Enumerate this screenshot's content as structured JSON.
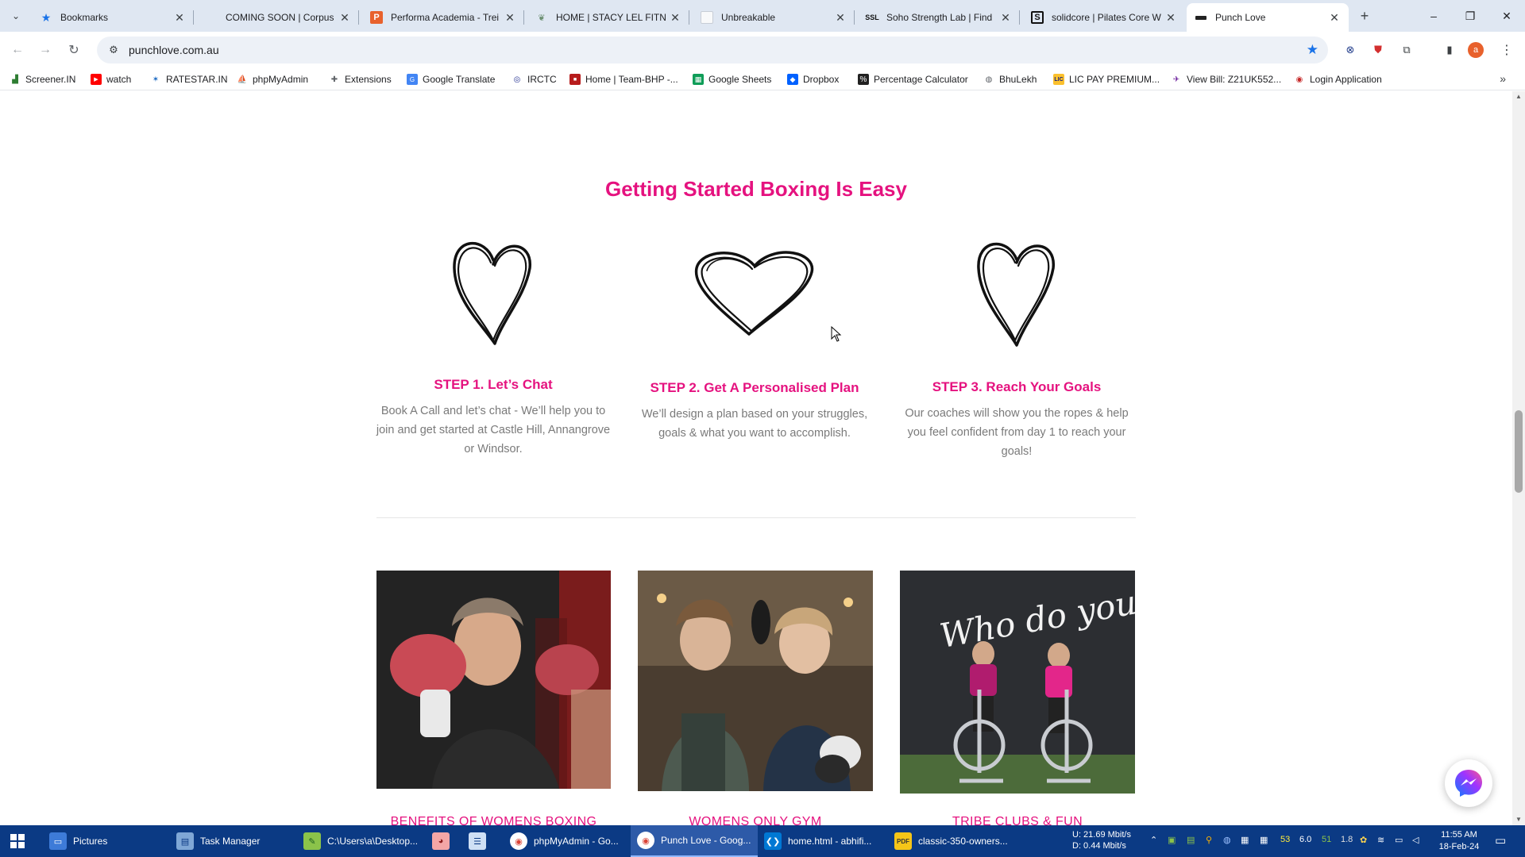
{
  "browser": {
    "tabs": [
      {
        "title": "Bookmarks",
        "icon": "star-icon",
        "active": false
      },
      {
        "title": "COMING SOON | Corpus",
        "icon": "blank-icon",
        "active": false
      },
      {
        "title": "Performa Academia - Trei",
        "icon": "performa-icon",
        "active": false
      },
      {
        "title": "HOME | STACY LEL FITNES",
        "icon": "leaf-icon",
        "active": false
      },
      {
        "title": "Unbreakable",
        "icon": "page-icon",
        "active": false
      },
      {
        "title": "Soho Strength Lab | Find",
        "icon": "ssl-icon",
        "active": false
      },
      {
        "title": "solidcore | Pilates Core W",
        "icon": "solidcore-icon",
        "active": false
      },
      {
        "title": "Punch Love",
        "icon": "punchlove-icon",
        "active": true
      }
    ],
    "new_tab": "+",
    "window_controls": {
      "minimize": "–",
      "restore": "❐",
      "close": "✕"
    },
    "url": "punchlove.com.au",
    "bookmarks": [
      {
        "label": "Screener.IN",
        "icon": "chart-icon",
        "color": "#2e7d32"
      },
      {
        "label": "watch",
        "icon": "youtube-icon",
        "color": "#ff0000"
      },
      {
        "label": "RATESTAR.IN",
        "icon": "ratestar-icon",
        "color": "#1565c0"
      },
      {
        "label": "phpMyAdmin",
        "icon": "phpmyadmin-icon",
        "color": "#f57c00"
      },
      {
        "label": "Extensions",
        "icon": "puzzle-icon",
        "color": "#5f6368"
      },
      {
        "label": "Google Translate",
        "icon": "translate-icon",
        "color": "#4285f4"
      },
      {
        "label": "IRCTC",
        "icon": "irctc-icon",
        "color": "#283593"
      },
      {
        "label": "Home | Team-BHP -...",
        "icon": "teambhp-icon",
        "color": "#b71c1c"
      },
      {
        "label": "Google Sheets",
        "icon": "sheets-icon",
        "color": "#0f9d58"
      },
      {
        "label": "Dropbox",
        "icon": "dropbox-icon",
        "color": "#0061ff"
      },
      {
        "label": "Percentage Calculator",
        "icon": "percent-icon",
        "color": "#212121"
      },
      {
        "label": "BhuLekh",
        "icon": "globe-icon",
        "color": "#5f6368"
      },
      {
        "label": "LIC PAY PREMIUM...",
        "icon": "lic-icon",
        "color": "#fbc02d"
      },
      {
        "label": "View Bill: Z21UK552...",
        "icon": "bill-icon",
        "color": "#6a1b9a"
      },
      {
        "label": "Login Application",
        "icon": "login-icon",
        "color": "#c62828"
      }
    ],
    "profile_initial": "a"
  },
  "page": {
    "section_title": "Getting Started Boxing Is Easy",
    "steps": [
      {
        "title": "STEP 1. Let’s Chat",
        "description": "Book A Call and let’s chat  - We’ll help you to join and get started at Castle Hill, Annangrove or Windsor."
      },
      {
        "title": "STEP 2. Get A Personalised Plan",
        "description": "We’ll design a plan based on your struggles, goals & what you want to accomplish."
      },
      {
        "title": "STEP 3. Reach Your Goals",
        "description": "Our coaches will show you the ropes & help you feel confident from day 1 to reach your goals!"
      }
    ],
    "cards": [
      {
        "caption": "BENEFITS OF WOMENS BOXING"
      },
      {
        "caption": "WOMENS ONLY GYM"
      },
      {
        "caption": "TRIBE CLUBS & FUN",
        "wall_text": "Who do you love?"
      }
    ],
    "accent_color": "#e5127f"
  },
  "taskbar": {
    "items": [
      {
        "label": "Pictures",
        "icon": "folder-icon",
        "active": false
      },
      {
        "label": "Task Manager",
        "icon": "taskmanager-icon",
        "active": false
      },
      {
        "label": "C:\\Users\\a\\Desktop...",
        "icon": "notepadpp-icon",
        "active": false
      },
      {
        "label": "",
        "icon": "pig-icon",
        "active": false
      },
      {
        "label": "",
        "icon": "notepad-icon",
        "active": false
      },
      {
        "label": "phpMyAdmin - Go...",
        "icon": "chrome-icon",
        "active": false
      },
      {
        "label": "Punch Love - Goog...",
        "icon": "chrome-icon",
        "active": true
      },
      {
        "label": "home.html - abhifi...",
        "icon": "vscode-icon",
        "active": false
      },
      {
        "label": "classic-350-owners...",
        "icon": "pdf-icon",
        "active": false
      }
    ],
    "network": {
      "up": "U:   21.69 Mbit/s",
      "down": "D:    0.44 Mbit/s"
    },
    "tray_numbers": [
      "53",
      "6.0",
      "51",
      "1.8"
    ],
    "time": "11:55 AM",
    "date": "18-Feb-24"
  }
}
